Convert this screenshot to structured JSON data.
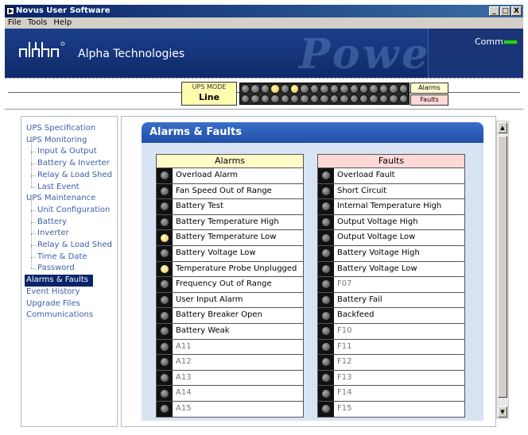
{
  "window": {
    "title": "Novus User Software",
    "min": "_",
    "max": "□",
    "close": "X"
  },
  "menu": [
    "File",
    "Tools",
    "Help"
  ],
  "banner": {
    "brand": "Alpha Technologies",
    "watermark": "Power",
    "comm_label": "Comm",
    "comm_color": "#2ec82e"
  },
  "status": {
    "mode_title": "UPS MODE",
    "mode_value": "Line",
    "alarms_tag": "Alarms",
    "faults_tag": "Faults",
    "led_on_indices": [
      3,
      5
    ]
  },
  "nav": [
    {
      "label": "UPS Specification",
      "level": 0
    },
    {
      "label": "UPS Monitoring",
      "level": 0
    },
    {
      "label": "Input & Output",
      "level": 1
    },
    {
      "label": "Battery & Inverter",
      "level": 1
    },
    {
      "label": "Relay & Load Shed",
      "level": 1
    },
    {
      "label": "Last Event",
      "level": 1
    },
    {
      "label": "UPS Maintenance",
      "level": 0
    },
    {
      "label": "Unit Configuration",
      "level": 1
    },
    {
      "label": "Battery",
      "level": 1
    },
    {
      "label": "Inverter",
      "level": 1
    },
    {
      "label": "Relay & Load Shed",
      "level": 1
    },
    {
      "label": "Time & Date",
      "level": 1
    },
    {
      "label": "Password",
      "level": 1
    },
    {
      "label": "Alarms & Faults",
      "level": 0,
      "active": true
    },
    {
      "label": "Event History",
      "level": 0
    },
    {
      "label": "Upgrade Files",
      "level": 0
    },
    {
      "label": "Communications",
      "level": 0
    }
  ],
  "main": {
    "title": "Alarms & Faults",
    "alarms_header": "Alarms",
    "faults_header": "Faults",
    "alarms": [
      {
        "label": "Overload Alarm",
        "on": false,
        "dim": false
      },
      {
        "label": "Fan Speed Out of Range",
        "on": false,
        "dim": false
      },
      {
        "label": "Battery Test",
        "on": false,
        "dim": false
      },
      {
        "label": "Battery Temperature High",
        "on": false,
        "dim": false
      },
      {
        "label": "Battery Temperature Low",
        "on": true,
        "dim": false
      },
      {
        "label": "Battery Voltage Low",
        "on": false,
        "dim": false
      },
      {
        "label": "Temperature Probe Unplugged",
        "on": true,
        "dim": false
      },
      {
        "label": "Frequency Out of Range",
        "on": false,
        "dim": false
      },
      {
        "label": "User Input Alarm",
        "on": false,
        "dim": false
      },
      {
        "label": "Battery Breaker Open",
        "on": false,
        "dim": false
      },
      {
        "label": "Battery Weak",
        "on": false,
        "dim": false
      },
      {
        "label": "A11",
        "on": false,
        "dim": true
      },
      {
        "label": "A12",
        "on": false,
        "dim": true
      },
      {
        "label": "A13",
        "on": false,
        "dim": true
      },
      {
        "label": "A14",
        "on": false,
        "dim": true
      },
      {
        "label": "A15",
        "on": false,
        "dim": true
      }
    ],
    "faults": [
      {
        "label": "Overload Fault",
        "on": false,
        "dim": false
      },
      {
        "label": "Short Circuit",
        "on": false,
        "dim": false
      },
      {
        "label": "Internal Temperature High",
        "on": false,
        "dim": false
      },
      {
        "label": "Output Voltage High",
        "on": false,
        "dim": false
      },
      {
        "label": "Output Voltage Low",
        "on": false,
        "dim": false
      },
      {
        "label": "Battery Voltage High",
        "on": false,
        "dim": false
      },
      {
        "label": "Battery Voltage Low",
        "on": false,
        "dim": false
      },
      {
        "label": "F07",
        "on": false,
        "dim": true
      },
      {
        "label": "Battery Fail",
        "on": false,
        "dim": false
      },
      {
        "label": "Backfeed",
        "on": false,
        "dim": false
      },
      {
        "label": "F10",
        "on": false,
        "dim": true
      },
      {
        "label": "F11",
        "on": false,
        "dim": true
      },
      {
        "label": "F12",
        "on": false,
        "dim": true
      },
      {
        "label": "F13",
        "on": false,
        "dim": true
      },
      {
        "label": "F14",
        "on": false,
        "dim": true
      },
      {
        "label": "F15",
        "on": false,
        "dim": true
      }
    ]
  }
}
